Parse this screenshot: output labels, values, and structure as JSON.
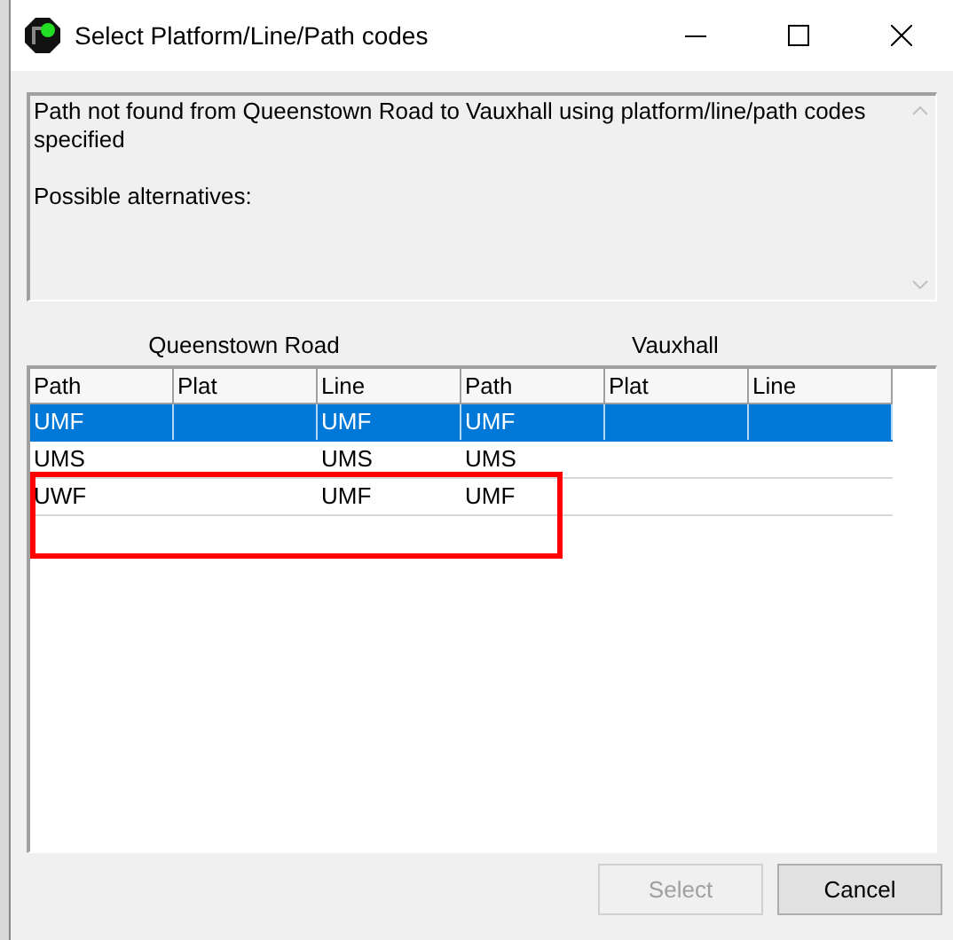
{
  "window": {
    "title": "Select Platform/Line/Path codes"
  },
  "message": {
    "paragraphs": [
      "Path not found from Queenstown Road to Vauxhall using platform/line/path codes specified",
      "Possible alternatives:"
    ]
  },
  "table": {
    "groups": [
      "Queenstown Road",
      "Vauxhall"
    ],
    "columns": [
      "Path",
      "Plat",
      "Line",
      "Path",
      "Plat",
      "Line"
    ],
    "rows": [
      {
        "cells": [
          "UMF",
          "",
          "UMF",
          "UMF",
          "",
          ""
        ],
        "selected": true
      },
      {
        "cells": [
          "UMS",
          "",
          "UMS",
          "UMS",
          "",
          ""
        ],
        "selected": false
      },
      {
        "cells": [
          "UWF",
          "",
          "UMF",
          "UMF",
          "",
          ""
        ],
        "selected": false
      }
    ]
  },
  "highlight_box": {
    "color": "#ff0000"
  },
  "buttons": [
    {
      "label": "Select",
      "disabled": true
    },
    {
      "label": "Cancel",
      "disabled": false
    }
  ]
}
